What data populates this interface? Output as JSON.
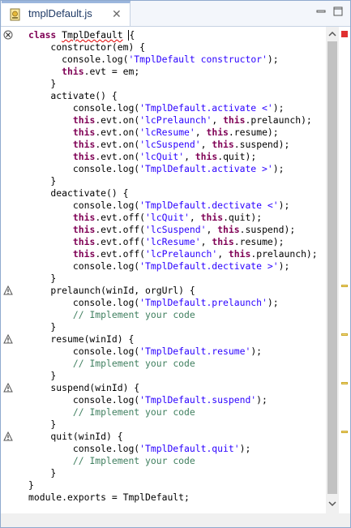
{
  "tab": {
    "title": "tmplDefault.js",
    "close": "✕"
  },
  "code_lines": [
    "class TmplDefault {",
    "    constructor(em) {",
    "      console.log('TmplDefault constructor');",
    "      this.evt = em;",
    "    }",
    "    activate() {",
    "        console.log('TmplDefault.activate <');",
    "        this.evt.on('lcPrelaunch', this.prelaunch);",
    "        this.evt.on('lcResume', this.resume);",
    "        this.evt.on('lcSuspend', this.suspend);",
    "        this.evt.on('lcQuit', this.quit);",
    "        console.log('TmplDefault.activate >');",
    "    }",
    "    deactivate() {",
    "        console.log('TmplDefault.dectivate <');",
    "        this.evt.off('lcQuit', this.quit);",
    "        this.evt.off('lcSuspend', this.suspend);",
    "        this.evt.off('lcResume', this.resume);",
    "        this.evt.off('lcPrelaunch', this.prelaunch);",
    "        console.log('TmplDefault.dectivate >');",
    "    }",
    "    prelaunch(winId, orgUrl) {",
    "        console.log('TmplDefault.prelaunch');",
    "        // Implement your code",
    "    }",
    "    resume(winId) {",
    "        console.log('TmplDefault.resume');",
    "        // Implement your code",
    "    }",
    "    suspend(winId) {",
    "        console.log('TmplDefault.suspend');",
    "        // Implement your code",
    "    }",
    "    quit(winId) {",
    "        console.log('TmplDefault.quit');",
    "        // Implement your code",
    "    }",
    "}",
    "module.exports = TmplDefault;"
  ],
  "error_lines": [
    0
  ],
  "warning_lines": [
    21,
    25,
    29,
    33
  ],
  "overview_warning_fractions": [
    0.53,
    0.63,
    0.73,
    0.83
  ],
  "colors": {
    "keyword": "#7f0055",
    "string": "#2a00ff",
    "comment": "#3f7f5f",
    "error": "#e00000",
    "warning": "#f5d676"
  }
}
